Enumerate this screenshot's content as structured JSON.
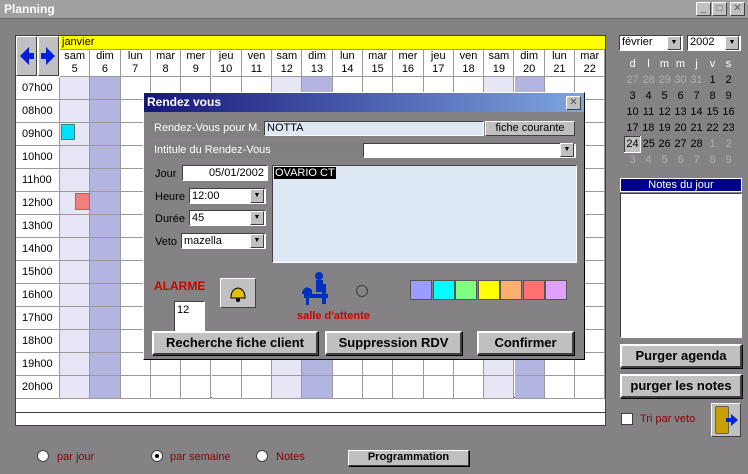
{
  "window": {
    "title": "Planning"
  },
  "planning": {
    "month": "janvier",
    "days": [
      {
        "name": "sam",
        "num": "5"
      },
      {
        "name": "dim",
        "num": "6"
      },
      {
        "name": "lun",
        "num": "7"
      },
      {
        "name": "mar",
        "num": "8"
      },
      {
        "name": "mer",
        "num": "9"
      },
      {
        "name": "jeu",
        "num": "10"
      },
      {
        "name": "ven",
        "num": "11"
      },
      {
        "name": "sam",
        "num": "12"
      },
      {
        "name": "dim",
        "num": "13"
      },
      {
        "name": "lun",
        "num": "14"
      },
      {
        "name": "mar",
        "num": "15"
      },
      {
        "name": "mer",
        "num": "16"
      },
      {
        "name": "jeu",
        "num": "17"
      },
      {
        "name": "ven",
        "num": "18"
      },
      {
        "name": "sam",
        "num": "19"
      },
      {
        "name": "dim",
        "num": "20"
      },
      {
        "name": "lun",
        "num": "21"
      },
      {
        "name": "mar",
        "num": "22"
      }
    ],
    "hours": [
      "07h00",
      "08h00",
      "09h00",
      "10h00",
      "11h00",
      "12h00",
      "13h00",
      "14h00",
      "15h00",
      "16h00",
      "17h00",
      "18h00",
      "19h00",
      "20h00"
    ]
  },
  "calendar": {
    "month": "février",
    "year": "2002",
    "weekdays": [
      "d",
      "l",
      "m",
      "m",
      "j",
      "v",
      "s"
    ],
    "rows": [
      [
        "27",
        "28",
        "29",
        "30",
        "31",
        "1",
        "2"
      ],
      [
        "3",
        "4",
        "5",
        "6",
        "7",
        "8",
        "9"
      ],
      [
        "10",
        "11",
        "12",
        "13",
        "14",
        "15",
        "16"
      ],
      [
        "17",
        "18",
        "19",
        "20",
        "21",
        "22",
        "23"
      ],
      [
        "24",
        "25",
        "26",
        "27",
        "28",
        "1",
        "2"
      ],
      [
        "3",
        "4",
        "5",
        "6",
        "7",
        "8",
        "9"
      ]
    ]
  },
  "notes": {
    "header": "Notes du jour"
  },
  "buttons": {
    "purger_agenda": "Purger agenda",
    "purger_notes": "purger les notes",
    "programmation": "Programmation"
  },
  "tri": {
    "label": "Tri par veto"
  },
  "views": {
    "par_jour": "par jour",
    "par_semaine": "par semaine",
    "notes": "Notes"
  },
  "dialog": {
    "title": "Rendez vous",
    "rdv_label": "Rendez-Vous pour M.",
    "rdv_value": "NOTTA",
    "fiche_courante": "fiche courante",
    "intitule_label": "Intitule du Rendez-Vous",
    "intitule_value": "",
    "jour_label": "Jour",
    "jour_value": "05/01/2002",
    "heure_label": "Heure",
    "heure_value": "12:00",
    "duree_label": "Durée",
    "duree_value": "45",
    "veto_label": "Veto",
    "veto_value": "mazella",
    "memo": "OVARIO CT",
    "alarme_label": "ALARME",
    "alarme_value": "12",
    "salle_label": "salle d'attente",
    "btn_recherche": "Recherche fiche client",
    "btn_suppression": "Suppression RDV",
    "btn_confirmer": "Confirmer",
    "colors": [
      "#9c9cff",
      "#00ffff",
      "#80ff80",
      "#ffff00",
      "#ffb070",
      "#ff7070",
      "#e0a0ff"
    ]
  }
}
